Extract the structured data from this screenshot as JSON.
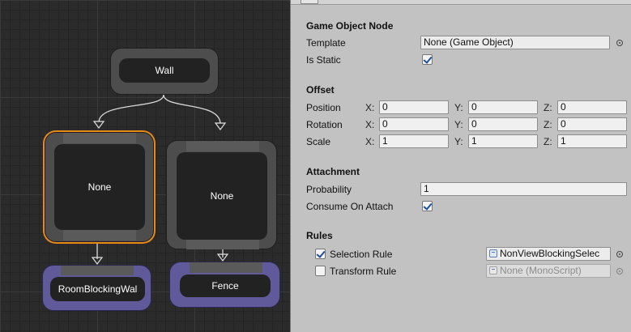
{
  "graph": {
    "nodes": {
      "wall": {
        "label": "Wall"
      },
      "none_left": {
        "label": "None"
      },
      "none_right": {
        "label": "None"
      },
      "room_blocking": {
        "label": "RoomBlockingWal"
      },
      "fence": {
        "label": "Fence"
      }
    }
  },
  "inspector": {
    "game_object_node": {
      "header": "Game Object Node",
      "template_label": "Template",
      "template_value": "None (Game Object)",
      "is_static_label": "Is Static",
      "is_static": true
    },
    "offset": {
      "header": "Offset",
      "rows": [
        {
          "label": "Position",
          "x": "0",
          "y": "0",
          "z": "0"
        },
        {
          "label": "Rotation",
          "x": "0",
          "y": "0",
          "z": "0"
        },
        {
          "label": "Scale",
          "x": "1",
          "y": "1",
          "z": "1"
        }
      ],
      "axis_x": "X:",
      "axis_y": "Y:",
      "axis_z": "Z:"
    },
    "attachment": {
      "header": "Attachment",
      "probability_label": "Probability",
      "probability_value": "1",
      "consume_label": "Consume On Attach",
      "consume_on_attach": true
    },
    "rules": {
      "header": "Rules",
      "selection_rule_label": "Selection Rule",
      "selection_rule_checked": true,
      "selection_rule_value": "NonViewBlockingSelec",
      "transform_rule_label": "Transform Rule",
      "transform_rule_checked": false,
      "transform_rule_value": "None (MonoScript)"
    }
  }
}
